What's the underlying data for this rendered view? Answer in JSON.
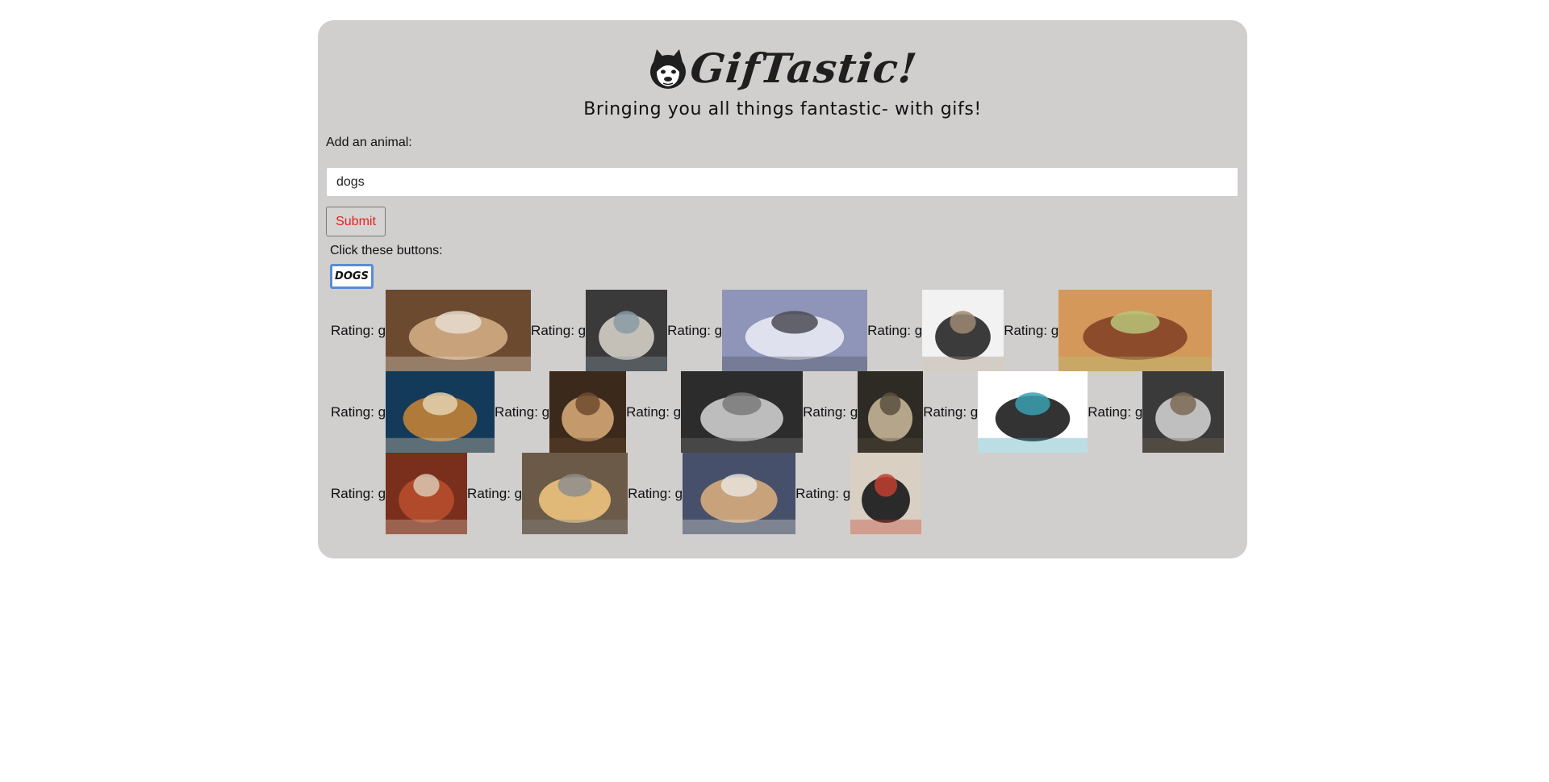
{
  "header": {
    "title": "GifTastic!",
    "subtitle": "Bringing you all things fantastic- with gifs!",
    "logo_icon": "doge-dog-icon"
  },
  "form": {
    "add_label": "Add an animal:",
    "input_value": "dogs",
    "submit_label": "Submit"
  },
  "buttons_section": {
    "label": "Click these buttons:",
    "buttons": [
      "DOGS"
    ]
  },
  "gifs": {
    "rating_text": "Rating: g",
    "items": [
      {
        "desc": "puppy-on-towel",
        "colors": [
          "#6b4a30",
          "#c8a27a",
          "#e6dccf"
        ]
      },
      {
        "desc": "dog-driving-car",
        "colors": [
          "#3a3a3a",
          "#c4c0b8",
          "#8a9aa5"
        ]
      },
      {
        "desc": "chinese-crested-snow",
        "colors": [
          "#8e95b8",
          "#dfe2ee",
          "#4b4b55"
        ]
      },
      {
        "desc": "husky-puppy",
        "colors": [
          "#f2f2f2",
          "#3b3b3b",
          "#9c8a73"
        ]
      },
      {
        "desc": "corgi-lying",
        "colors": [
          "#d3985a",
          "#8c4b2a",
          "#b8c47a"
        ]
      },
      {
        "desc": "dogs-group-blue",
        "colors": [
          "#143a5a",
          "#b07a3a",
          "#e4d2b0"
        ]
      },
      {
        "desc": "pug-sitting",
        "colors": [
          "#3b2a1c",
          "#c49a6c",
          "#6e4a2e"
        ]
      },
      {
        "desc": "black-white-dog-bed",
        "colors": [
          "#2c2c2c",
          "#bdbdbd",
          "#7a7a7a"
        ]
      },
      {
        "desc": "dog-in-woods",
        "colors": [
          "#2e2a24",
          "#b5a58a",
          "#5b4f3f"
        ]
      },
      {
        "desc": "good-morning-cartoon",
        "colors": [
          "#ffffff",
          "#333333",
          "#3aa0b0"
        ]
      },
      {
        "desc": "dog-on-skateboard",
        "colors": [
          "#3a3a3a",
          "#bfbfbf",
          "#7b6a55"
        ]
      },
      {
        "desc": "dogs-red-floor",
        "colors": [
          "#7a2e1c",
          "#b04a2a",
          "#d9c7b0"
        ]
      },
      {
        "desc": "golden-retriever",
        "colors": [
          "#6b5a48",
          "#e0b878",
          "#8d8d8d"
        ]
      },
      {
        "desc": "dog-in-bed",
        "colors": [
          "#46506a",
          "#c7a27a",
          "#e8e3dc"
        ]
      },
      {
        "desc": "dogs-pulling-sled",
        "colors": [
          "#d9cfc2",
          "#2a2a2a",
          "#c04030"
        ]
      }
    ]
  }
}
